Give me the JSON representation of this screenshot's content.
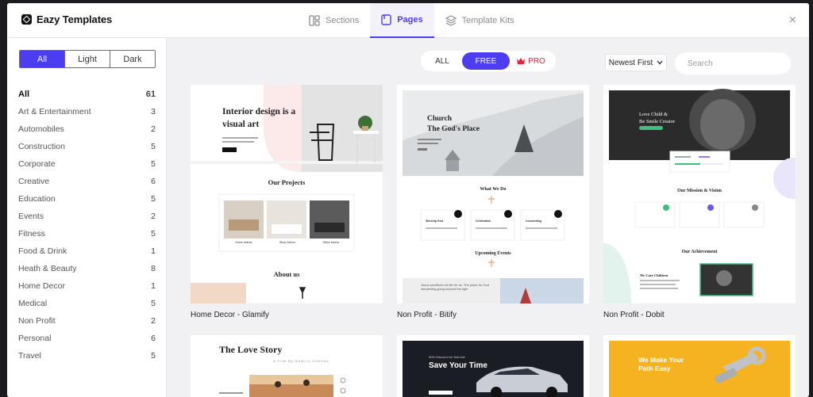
{
  "header": {
    "brand": "Eazy Templates",
    "tabs": [
      {
        "label": "Sections",
        "icon": "sections-icon"
      },
      {
        "label": "Pages",
        "icon": "pages-icon",
        "active": true
      },
      {
        "label": "Template Kits",
        "icon": "layers-icon"
      }
    ],
    "close": "×"
  },
  "sidebar": {
    "theme_filter": [
      "All",
      "Light",
      "Dark"
    ],
    "categories": [
      {
        "name": "All",
        "count": "61"
      },
      {
        "name": "Art & Entertainment",
        "count": "3"
      },
      {
        "name": "Automobiles",
        "count": "2"
      },
      {
        "name": "Construction",
        "count": "5"
      },
      {
        "name": "Corporate",
        "count": "5"
      },
      {
        "name": "Creative",
        "count": "6"
      },
      {
        "name": "Education",
        "count": "5"
      },
      {
        "name": "Events",
        "count": "2"
      },
      {
        "name": "Fitness",
        "count": "5"
      },
      {
        "name": "Food & Drink",
        "count": "1"
      },
      {
        "name": "Heath & Beauty",
        "count": "8"
      },
      {
        "name": "Home Decor",
        "count": "1"
      },
      {
        "name": "Medical",
        "count": "5"
      },
      {
        "name": "Non Profit",
        "count": "2"
      },
      {
        "name": "Personal",
        "count": "6"
      },
      {
        "name": "Travel",
        "count": "5"
      }
    ]
  },
  "filters": {
    "all": "ALL",
    "free": "FREE",
    "pro": "PRO"
  },
  "sort": {
    "label": "Newest First"
  },
  "search": {
    "placeholder": "Search"
  },
  "colors": {
    "accent": "#4c3df2",
    "pro": "#e8213d"
  },
  "cards": [
    {
      "title": "Home Decor - Glamify",
      "hero": [
        "Interior design is a",
        "visual art"
      ],
      "section1": "Our Projects",
      "items": [
        "Home Interior",
        "Shop Interior",
        "Office Interior"
      ],
      "section2": "About us"
    },
    {
      "title": "Non Profit - Bitify",
      "hero": [
        "Church",
        "The God's Place"
      ],
      "section1": "What We Do",
      "items": [
        "Worship God",
        "Celebration",
        "Counselling"
      ],
      "section2": "Upcoming Events",
      "event": "Jesus sacrifices his life for us. The place for God storytelling going beyond the light"
    },
    {
      "title": "Non Profit - Dobit",
      "hero": [
        "Love Child &",
        "Be Smile Creator"
      ],
      "section1": "Our Mission & Vision",
      "section2": "Our Achievement",
      "caption": "We Care Children"
    },
    {
      "title": "",
      "hero": [
        "The Love Story"
      ],
      "sub": "A Film By Beatrix Charles"
    },
    {
      "title": "",
      "hero": [
        "Save Your Time"
      ],
      "sub": "50% Discount for first ride"
    },
    {
      "title": "",
      "hero": [
        "We Make Your",
        "Path Easy"
      ]
    }
  ]
}
